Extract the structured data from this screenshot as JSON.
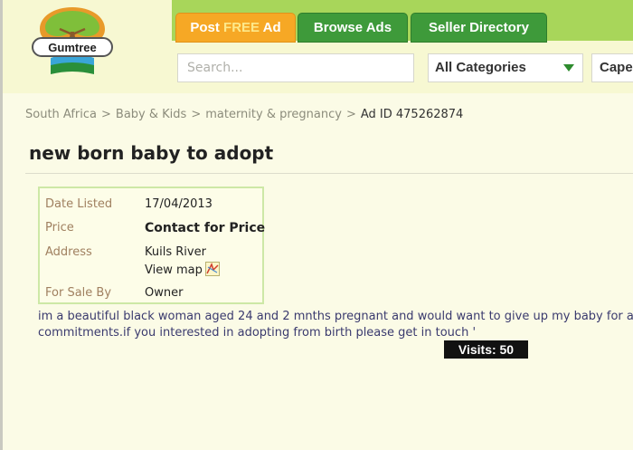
{
  "brand": {
    "logo_text": "Gumtree"
  },
  "nav": {
    "post_prefix": "Post ",
    "post_free": "FREE",
    "post_suffix": " Ad",
    "browse": "Browse Ads",
    "seller": "Seller Directory"
  },
  "search": {
    "placeholder": "Search...",
    "category": "All Categories",
    "location": "Cape"
  },
  "breadcrumb": {
    "items": [
      "South Africa",
      "Baby & Kids",
      "maternity & pregnancy"
    ],
    "separator": ">",
    "ad_id": "Ad ID 475262874"
  },
  "ad": {
    "title": "new born baby to adopt",
    "date_label": "Date Listed",
    "date_value": "17/04/2013",
    "price_label": "Price",
    "price_value": "Contact for Price",
    "address_label": "Address",
    "address_value": "Kuils River",
    "map_link": "View map",
    "seller_label": "For Sale By",
    "seller_value": "Owner",
    "description_line1": "im a beautiful black woman aged 24 and 2 mnths pregnant and would want to give up my baby for a",
    "description_line2": "commitments.if you interested in adopting from birth please get in touch '"
  },
  "visits": {
    "label": "Visits: 50"
  },
  "colors": {
    "nav_post": "#f6a825",
    "nav_green": "#3e9a3a",
    "header_band": "#a8d65a",
    "page_bg": "#fbfbe6"
  },
  "icons": [
    "tree-logo-icon",
    "dropdown-arrow-icon",
    "map-icon"
  ]
}
